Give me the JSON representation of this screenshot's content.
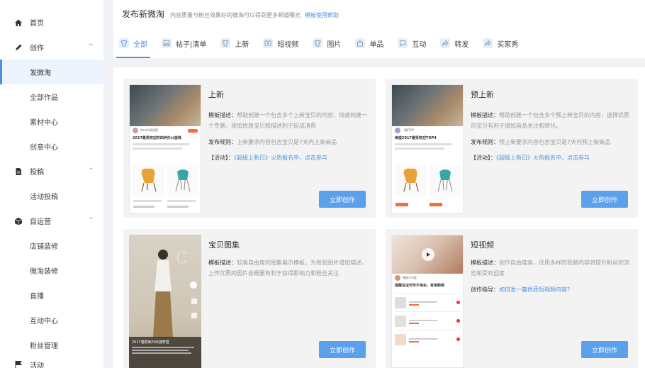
{
  "sidebar": {
    "items": [
      {
        "type": "group",
        "label": "首页",
        "icon": "home-icon"
      },
      {
        "type": "group",
        "label": "创作",
        "icon": "pen-icon",
        "chevron": "^"
      },
      {
        "type": "item",
        "label": "发微淘",
        "active": true
      },
      {
        "type": "item",
        "label": "全部作品"
      },
      {
        "type": "item",
        "label": "素材中心"
      },
      {
        "type": "item",
        "label": "创意中心"
      },
      {
        "type": "group",
        "label": "投稿",
        "icon": "document-icon",
        "chevron": "^"
      },
      {
        "type": "item",
        "label": "活动投稿"
      },
      {
        "type": "group",
        "label": "自运营",
        "icon": "box-icon",
        "chevron": "^"
      },
      {
        "type": "item",
        "label": "店铺装修"
      },
      {
        "type": "item",
        "label": "微淘装修"
      },
      {
        "type": "item",
        "label": "直播"
      },
      {
        "type": "item",
        "label": "互动中心"
      },
      {
        "type": "item",
        "label": "粉丝管理"
      },
      {
        "type": "group",
        "label": "活动",
        "icon": "flag-icon"
      }
    ]
  },
  "header": {
    "title": "发布新微淘",
    "subtitle": "内容质量与粉丝效果好的微淘可以得到更多频道曝光",
    "help_link": "模板使用帮助"
  },
  "tabs": [
    {
      "label": "全部",
      "active": true,
      "icon": "shirt-icon"
    },
    {
      "label": "帖子|清单",
      "icon": "image-icon"
    },
    {
      "label": "上新",
      "icon": "shirt-icon"
    },
    {
      "label": "短视频",
      "icon": "video-icon"
    },
    {
      "label": "图片",
      "icon": "shirt-icon"
    },
    {
      "label": "单品",
      "icon": "bag-icon"
    },
    {
      "label": "互动",
      "icon": "chat-icon"
    },
    {
      "label": "转发",
      "icon": "share-icon"
    },
    {
      "label": "买家秀",
      "icon": "share-icon"
    }
  ],
  "cards": [
    {
      "title": "上新",
      "desc_key": "模板描述：",
      "desc": "帮助创建一个包含多个上新宝贝的内容，快速构建一个专题。添加优质宝贝和描述利于促成消费",
      "rule_key": "发布规则：",
      "rule": "上新要求内容包含宝贝是7天内上架商品",
      "activity_key": "【活动】：",
      "activity": "《超级上新日》火热报名中，点击参与",
      "button": "立即创作",
      "thumb_title": "2017最受欢迎的四种办公座椅",
      "thumb_author": "Nordic家居馆"
    },
    {
      "title": "预上新",
      "desc_key": "模板描述：",
      "desc": "帮助创建一个包含多个预上新宝贝的内容，选择优质的宝贝有利于增加商品关注和转化。",
      "rule_key": "发布规则：",
      "rule": "预上新要求内容包含宝贝是7天内预上架商品",
      "activity_key": "【活动】：",
      "activity": "《超级上新日》火热报名中，点击参与",
      "button": "立即创作",
      "thumb_title": "美座2017最受欢迎TOP4",
      "thumb_author": "飞鹅TOP"
    },
    {
      "title": "宝贝图集",
      "desc_key": "模板描述：",
      "desc": "较高自由度的图集展示模板，为每张图片增加描述。上传优质的图片会概要有利于获得影响力和粉丝关注",
      "button": "立即创作",
      "thumb_title": "2017春款秋日出游穿搭"
    },
    {
      "title": "短视频",
      "desc_key": "模板描述：",
      "desc": "创作自由度高，优质多样的视频内容将提升粉丝的浏览和受欢迎度",
      "guide_key": "创作指导：",
      "guide": "如何发一篇优质短视频内容？",
      "button": "立即创作",
      "thumb_title": "提醒宝宝可怜不用买，有用购物",
      "thumb_author": "播放小可爱"
    }
  ],
  "colors": {
    "accent": "#4a90e2",
    "button": "#5aa0ea",
    "page_bg": "#f0f2f5",
    "card_bg": "#f3f3f3"
  }
}
